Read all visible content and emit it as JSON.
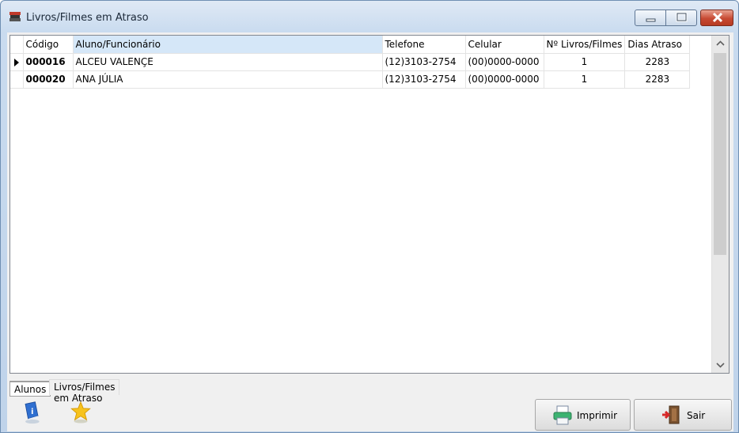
{
  "window": {
    "title": "Livros/Filmes em Atraso"
  },
  "grid": {
    "columns": [
      "Código",
      "Aluno/Funcionário",
      "Telefone",
      "Celular",
      "Nº Livros/Filmes",
      "Dias Atraso"
    ],
    "rows": [
      {
        "codigo": "000016",
        "nome": "ALCEU VALENÇE",
        "telefone": "(12)3103-2754",
        "celular": "(00)0000-0000",
        "livros": "1",
        "dias": "2283"
      },
      {
        "codigo": "000020",
        "nome": "ANA JÚLIA",
        "telefone": "(12)3103-2754",
        "celular": "(00)0000-0000",
        "livros": "1",
        "dias": "2283"
      }
    ]
  },
  "tabs": [
    "Alunos",
    "Livros/Filmes em Atraso"
  ],
  "buttons": {
    "print": "Imprimir",
    "exit": "Sair"
  },
  "icons": [
    "app-icon",
    "help-book-icon",
    "star-icon",
    "printer-icon",
    "exit-door-icon"
  ]
}
